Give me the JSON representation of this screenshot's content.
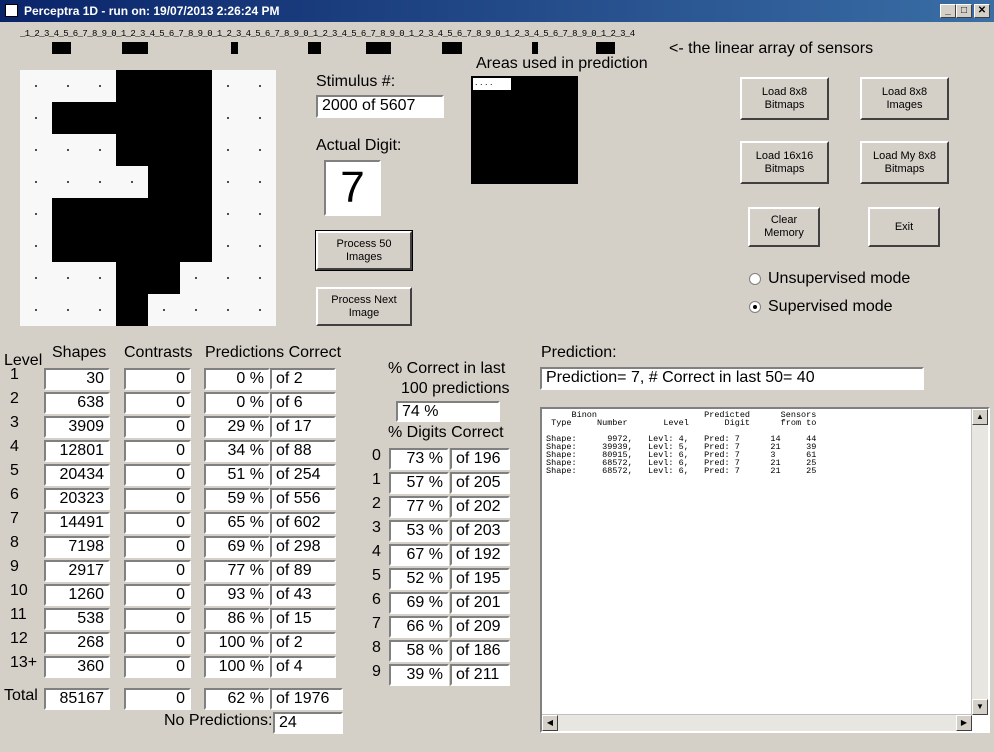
{
  "window": {
    "title": "Perceptra 1D  - run on: 19/07/2013  2:26:24 PM",
    "minimize": "_",
    "maximize": "□",
    "close": "✕"
  },
  "sensors": {
    "tick_text": "_1_2_3_4_5_6_7_8_9_0_1_2_3_4_5_6_7_8_9_0_1_2_3_4_5_6_7_8_9_0_1_2_3_4_5_6_7_8_9_0_1_2_3_4_5_6_7_8_9_0_1_2_3_4_5_6_7_8_9_0_1_2_3_4",
    "label": "<- the linear array of sensors",
    "black_segments": [
      [
        5,
        8
      ],
      [
        16,
        20
      ],
      [
        33,
        34
      ],
      [
        45,
        47
      ],
      [
        54,
        58
      ],
      [
        66,
        69
      ],
      [
        80,
        81
      ],
      [
        90,
        93
      ]
    ],
    "total": 100
  },
  "digit_image": {
    "grid": [
      "00011100",
      "01111100",
      "00011100",
      "00001100",
      "01111100",
      "01111100",
      "00011000",
      "00010000"
    ],
    "rows": 8,
    "cols": 8
  },
  "stimulus": {
    "label": "Stimulus #:",
    "value": "2000  of 5607"
  },
  "actual_digit": {
    "label": "Actual Digit:",
    "value": "7"
  },
  "areas": {
    "label": "Areas used in prediction",
    "hint": ". . . ."
  },
  "buttons": {
    "process50": "Process 50\nImages",
    "processNext": "Process Next\nImage",
    "load8x8bitmaps": "Load 8x8\nBitmaps",
    "load8x8images": "Load 8x8\nImages",
    "load16x16bitmaps": "Load 16x16\nBitmaps",
    "loadMy8x8bitmaps": "Load My 8x8\nBitmaps",
    "clearMemory": "Clear Memory",
    "exit": "Exit"
  },
  "modes": {
    "unsupervised": "Unsupervised mode",
    "supervised": "Supervised mode",
    "selected": "supervised"
  },
  "table": {
    "headers": {
      "level": "Level",
      "shapes": "Shapes",
      "contrasts": "Contrasts",
      "predictions": "Predictions Correct"
    },
    "rows": [
      {
        "level": "1",
        "shapes": "30",
        "contrasts": "0",
        "pct": "0 %",
        "of": "of 2"
      },
      {
        "level": "2",
        "shapes": "638",
        "contrasts": "0",
        "pct": "0 %",
        "of": "of 6"
      },
      {
        "level": "3",
        "shapes": "3909",
        "contrasts": "0",
        "pct": "29 %",
        "of": "of 17"
      },
      {
        "level": "4",
        "shapes": "12801",
        "contrasts": "0",
        "pct": "34 %",
        "of": "of 88"
      },
      {
        "level": "5",
        "shapes": "20434",
        "contrasts": "0",
        "pct": "51 %",
        "of": "of 254"
      },
      {
        "level": "6",
        "shapes": "20323",
        "contrasts": "0",
        "pct": "59 %",
        "of": "of 556"
      },
      {
        "level": "7",
        "shapes": "14491",
        "contrasts": "0",
        "pct": "65 %",
        "of": "of 602"
      },
      {
        "level": "8",
        "shapes": "7198",
        "contrasts": "0",
        "pct": "69 %",
        "of": "of 298"
      },
      {
        "level": "9",
        "shapes": "2917",
        "contrasts": "0",
        "pct": "77 %",
        "of": "of 89"
      },
      {
        "level": "10",
        "shapes": "1260",
        "contrasts": "0",
        "pct": "93 %",
        "of": "of 43"
      },
      {
        "level": "11",
        "shapes": "538",
        "contrasts": "0",
        "pct": "86 %",
        "of": "of 15"
      },
      {
        "level": "12",
        "shapes": "268",
        "contrasts": "0",
        "pct": "100 %",
        "of": "of 2"
      },
      {
        "level": "13+",
        "shapes": "360",
        "contrasts": "0",
        "pct": "100 %",
        "of": "of 4"
      }
    ],
    "total": {
      "label": "Total",
      "shapes": "85167",
      "contrasts": "0",
      "pct": "62 %",
      "of": "of 1976"
    },
    "no_predictions": {
      "label": "No Predictions:",
      "value": "24"
    }
  },
  "last100": {
    "label1": "% Correct in last",
    "label2": "100 predictions",
    "value": "74 %"
  },
  "digits": {
    "label": "% Digits Correct",
    "rows": [
      {
        "d": "0",
        "pct": "73 %",
        "of": "of 196"
      },
      {
        "d": "1",
        "pct": "57 %",
        "of": "of 205"
      },
      {
        "d": "2",
        "pct": "77 %",
        "of": "of 202"
      },
      {
        "d": "3",
        "pct": "53 %",
        "of": "of 203"
      },
      {
        "d": "4",
        "pct": "67 %",
        "of": "of 192"
      },
      {
        "d": "5",
        "pct": "52 %",
        "of": "of 195"
      },
      {
        "d": "6",
        "pct": "69 %",
        "of": "of 201"
      },
      {
        "d": "7",
        "pct": "66 %",
        "of": "of 209"
      },
      {
        "d": "8",
        "pct": "58 %",
        "of": "of 186"
      },
      {
        "d": "9",
        "pct": "39 %",
        "of": "of 211"
      }
    ]
  },
  "prediction": {
    "label": "Prediction:",
    "value": "Prediction= 7, # Correct in last 50= 40",
    "output": "     Binon                     Predicted      Sensors\n Type     Number       Level       Digit      from to\n\nShape:      9972,   Levl: 4,   Pred: 7      14     44\nShape:     39939,   Levl: 5,   Pred: 7      21     39\nShape:     80915,   Levl: 6,   Pred: 7      3      61\nShape:     68572,   Levl: 6,   Pred: 7      21     25\nShape:     68572,   Levl: 6,   Pred: 7      21     25"
  }
}
